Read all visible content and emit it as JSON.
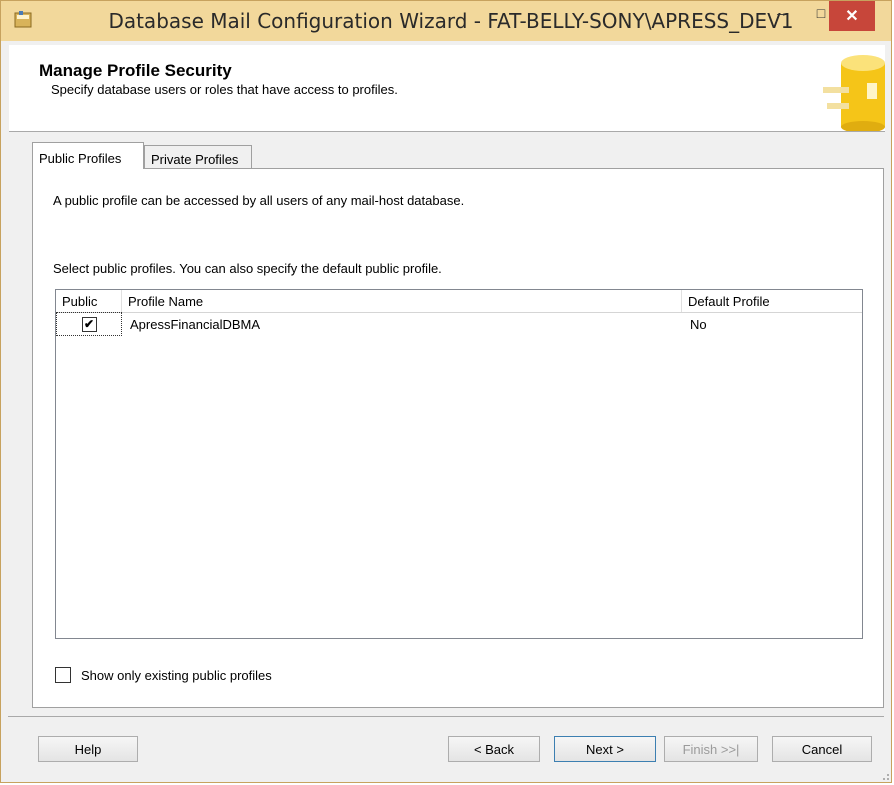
{
  "window": {
    "title": "Database Mail Configuration Wizard - FAT-BELLY-SONY\\APRESS_DEV1",
    "minimize_glyph": "–",
    "maximize_glyph": "□",
    "close_glyph": "✕",
    "titlebar_color": "#f2d89b",
    "close_color": "#c7463a"
  },
  "header": {
    "title": "Manage Profile Security",
    "subtitle": "Specify database users or roles that have access to profiles."
  },
  "tabs": [
    {
      "label": "Public Profiles",
      "active": true
    },
    {
      "label": "Private Profiles",
      "active": false
    }
  ],
  "panel": {
    "description": "A public profile can be accessed by all users of any mail-host database.",
    "select_text": "Select public profiles. You can also specify the default public profile."
  },
  "grid": {
    "columns": [
      "Public",
      "Profile Name",
      "Default Profile"
    ],
    "rows": [
      {
        "public_checked": true,
        "check_glyph": "✔",
        "profile_name": "ApressFinancialDBMA",
        "default_profile": "No"
      }
    ]
  },
  "show_only": {
    "label": "Show only existing public profiles",
    "checked": false
  },
  "buttons": {
    "help": "Help",
    "back": "< Back",
    "next": "Next >",
    "finish": "Finish >>|",
    "cancel": "Cancel"
  },
  "icons": {
    "app": "database-mail-icon",
    "header_graphic": "database-cylinder-graphic",
    "resize": "resize-grip-icon"
  }
}
